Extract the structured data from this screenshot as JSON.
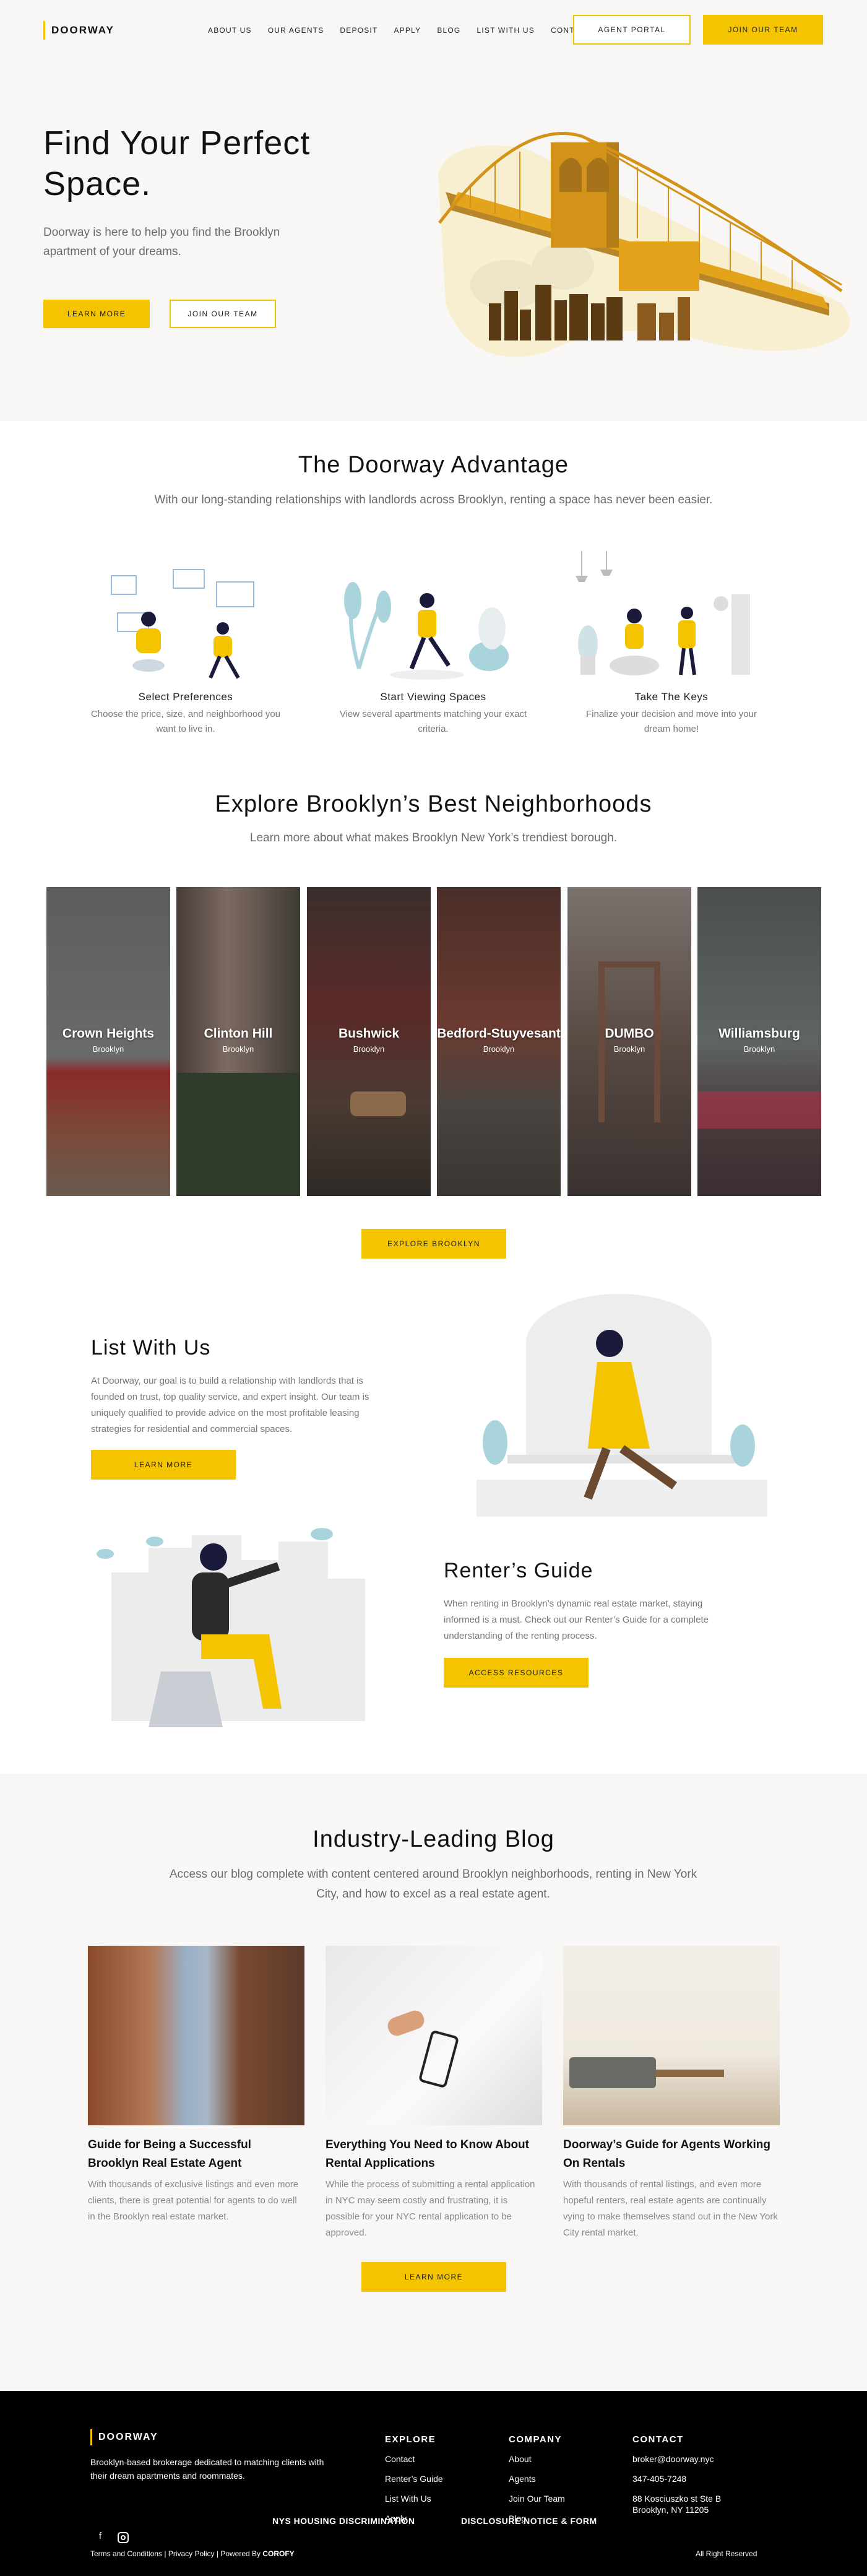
{
  "brand": {
    "name": "DOORWAY",
    "accent": "#f5c400"
  },
  "nav": {
    "items": [
      "ABOUT US",
      "OUR AGENTS",
      "DEPOSIT",
      "APPLY",
      "BLOG",
      "LIST WITH US",
      "CONTACT"
    ],
    "agent_portal": "AGENT PORTAL",
    "join_team": "JOIN OUR TEAM"
  },
  "hero": {
    "title": "Find Your Perfect Space.",
    "subtitle": "Doorway is here to help you find the Brooklyn apartment of your dreams.",
    "learn_more": "LEARN MORE",
    "join_team": "JOIN OUR TEAM"
  },
  "advantage": {
    "title": "The Doorway Advantage",
    "subtitle": "With our long-standing relationships with landlords across Brooklyn, renting a space has never been easier.",
    "steps": [
      {
        "title": "Select Preferences",
        "desc": "Choose the price, size, and neighborhood you want to live in."
      },
      {
        "title": "Start Viewing Spaces",
        "desc": "View several apartments matching your exact criteria."
      },
      {
        "title": "Take The Keys",
        "desc": "Finalize your decision and move into your dream home!"
      }
    ]
  },
  "explore": {
    "title": "Explore Brooklyn’s Best Neighborhoods",
    "subtitle": "Learn more about what makes Brooklyn New York’s trendiest borough.",
    "button": "EXPLORE BROOKLYN",
    "neighborhoods": [
      {
        "name": "Crown Heights",
        "borough": "Brooklyn"
      },
      {
        "name": "Clinton Hill",
        "borough": "Brooklyn"
      },
      {
        "name": "Bushwick",
        "borough": "Brooklyn"
      },
      {
        "name": "Bedford-Stuyvesant",
        "borough": "Brooklyn"
      },
      {
        "name": "DUMBO",
        "borough": "Brooklyn"
      },
      {
        "name": "Williamsburg",
        "borough": "Brooklyn"
      }
    ]
  },
  "list_with_us": {
    "title": "List With Us",
    "body": "At Doorway, our goal is to build a relationship with landlords that is founded on trust, top quality service, and expert insight. Our team is uniquely qualified to provide advice on the most profitable leasing strategies for residential and commercial spaces.",
    "button": "LEARN MORE"
  },
  "renters_guide": {
    "title": "Renter’s Guide",
    "body": "When renting in Brooklyn’s dynamic real estate market, staying informed is a must. Check out our Renter’s Guide for a complete understanding of the renting process.",
    "button": "ACCESS RESOURCES"
  },
  "blog": {
    "title": "Industry-Leading Blog",
    "subtitle": "Access our blog complete with content centered around Brooklyn neighborhoods, renting in New York City, and how to excel as a real estate agent.",
    "button": "LEARN MORE",
    "posts": [
      {
        "title": "Guide for Being a Successful Brooklyn Real Estate Agent",
        "desc": "With thousands of exclusive listings and even more clients, there is great potential for agents to do well in the Brooklyn real estate market."
      },
      {
        "title": "Everything You Need to Know About Rental Applications",
        "desc": "While the process of submitting a rental application in NYC may seem costly and frustrating, it is possible for your NYC rental application to be approved."
      },
      {
        "title": "Doorway’s Guide for Agents Working On Rentals",
        "desc": "With thousands of rental listings, and even more hopeful renters, real estate agents are continually vying to make themselves stand out in the New York City rental market."
      }
    ]
  },
  "footer": {
    "logo": "DOORWAY",
    "tagline": "Brooklyn-based brokerage dedicated to matching clients with their dream apartments and roommates.",
    "explore": {
      "heading": "EXPLORE",
      "links": [
        "Contact",
        "Renter’s Guide",
        "List With Us",
        "Apply"
      ]
    },
    "company": {
      "heading": "COMPANY",
      "links": [
        "About",
        "Agents",
        "Join Our Team",
        "Blog"
      ]
    },
    "contact": {
      "heading": "CONTACT",
      "email": "broker@doorway.nyc",
      "phone": "347-405-7248",
      "address1": "88 Kosciuszko st Ste B",
      "address2": "Brooklyn, NY 11205"
    },
    "nys": "NYS HOUSING DISCRIMINATION",
    "disclosure": "DISCLOSURE NOTICE & FORM",
    "legal": "Terms and Conditions | Privacy Policy | Powered By ",
    "powered": "COROFY",
    "rights": "All Right Reserved",
    "social": [
      "facebook-icon",
      "instagram-icon"
    ]
  }
}
